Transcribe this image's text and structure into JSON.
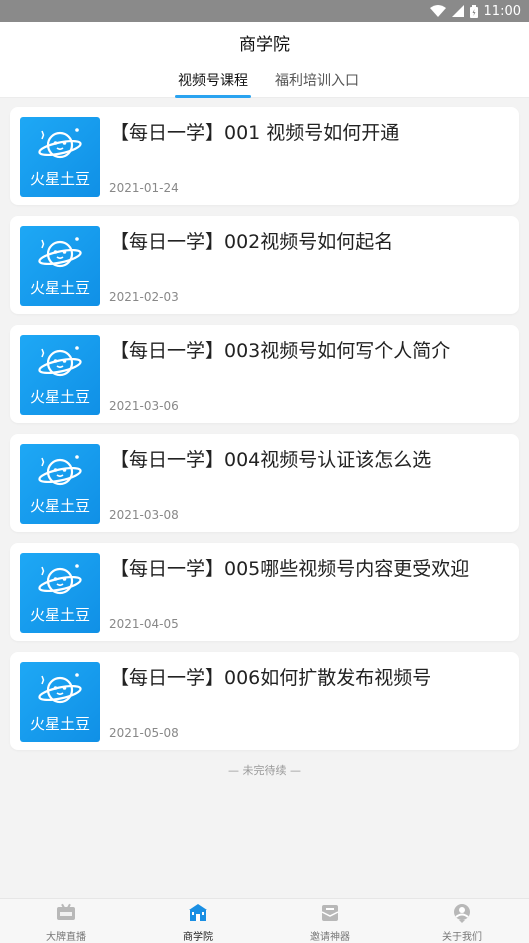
{
  "status_bar": {
    "time": "11:00",
    "icons": [
      "wifi-icon",
      "signal-icon",
      "battery-icon"
    ]
  },
  "header": {
    "title": "商学院"
  },
  "tabs": [
    {
      "label": "视频号课程",
      "active": true
    },
    {
      "label": "福利培训入口",
      "active": false
    }
  ],
  "courses": [
    {
      "thumb_brand": "火星土豆",
      "title": "【每日一学】001 视频号如何开通",
      "date": "2021-01-24"
    },
    {
      "thumb_brand": "火星土豆",
      "title": "【每日一学】002视频号如何起名",
      "date": "2021-02-03"
    },
    {
      "thumb_brand": "火星土豆",
      "title": "【每日一学】003视频号如何写个人简介",
      "date": "2021-03-06"
    },
    {
      "thumb_brand": "火星土豆",
      "title": "【每日一学】004视频号认证该怎么选",
      "date": "2021-03-08"
    },
    {
      "thumb_brand": "火星土豆",
      "title": "【每日一学】005哪些视频号内容更受欢迎",
      "date": "2021-04-05"
    },
    {
      "thumb_brand": "火星土豆",
      "title": "【每日一学】006如何扩散发布视频号",
      "date": "2021-05-08"
    }
  ],
  "footer_note": "— 未完待续 —",
  "bottom_nav": [
    {
      "label": "大牌直播",
      "icon": "live-icon",
      "active": false
    },
    {
      "label": "商学院",
      "icon": "school-icon",
      "active": true
    },
    {
      "label": "邀请神器",
      "icon": "invite-icon",
      "active": false
    },
    {
      "label": "关于我们",
      "icon": "about-icon",
      "active": false
    }
  ],
  "colors": {
    "accent": "#2aa3f0",
    "thumb_blue": "#1a9cf0",
    "status_bar": "#8a8a8a"
  }
}
